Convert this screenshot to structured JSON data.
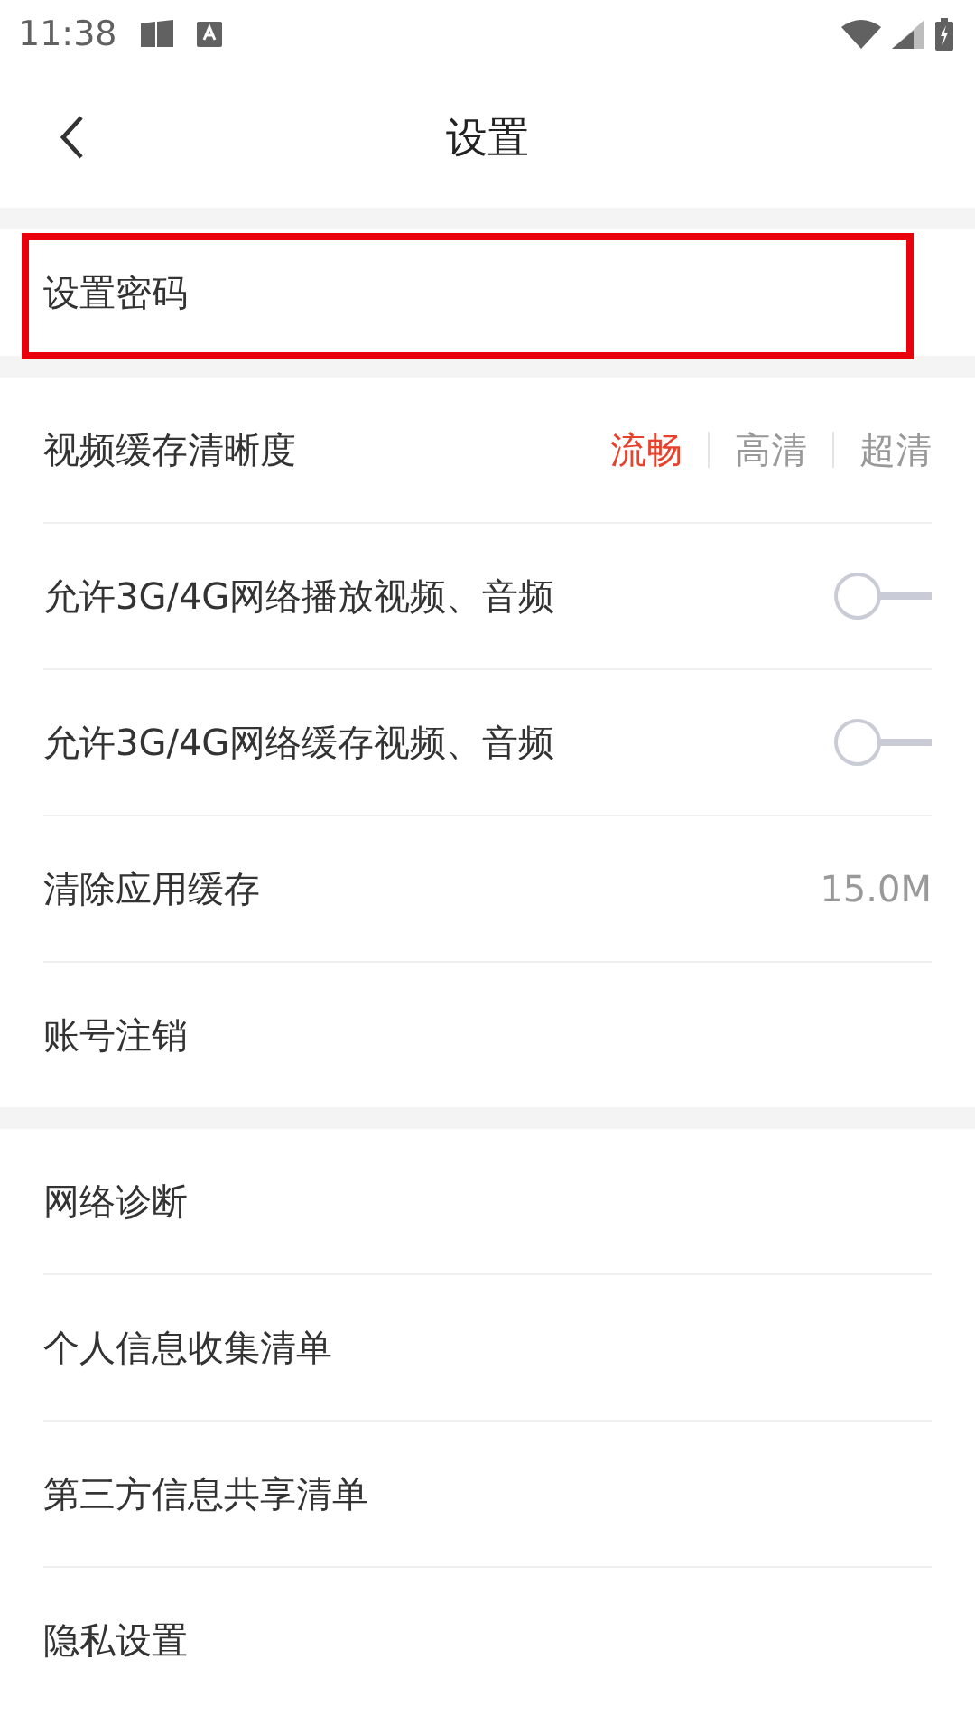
{
  "status_bar": {
    "time": "11:38"
  },
  "header": {
    "title": "设置"
  },
  "sections": [
    {
      "items": [
        {
          "kind": "plain",
          "label": "设置密码",
          "highlighted": true
        }
      ]
    },
    {
      "items": [
        {
          "kind": "quality",
          "label": "视频缓存清晰度",
          "options": [
            {
              "label": "流畅",
              "selected": true
            },
            {
              "label": "高清",
              "selected": false
            },
            {
              "label": "超清",
              "selected": false
            }
          ]
        },
        {
          "kind": "toggle",
          "label": "允许3G/4G网络播放视频、音频",
          "on": false
        },
        {
          "kind": "toggle",
          "label": "允许3G/4G网络缓存视频、音频",
          "on": false
        },
        {
          "kind": "value",
          "label": "清除应用缓存",
          "value": "15.0M"
        },
        {
          "kind": "plain",
          "label": "账号注销",
          "highlighted": false
        }
      ]
    },
    {
      "items": [
        {
          "kind": "plain",
          "label": "网络诊断",
          "highlighted": false
        },
        {
          "kind": "plain",
          "label": "个人信息收集清单",
          "highlighted": false
        },
        {
          "kind": "plain",
          "label": "第三方信息共享清单",
          "highlighted": false
        },
        {
          "kind": "plain",
          "label": "隐私设置",
          "highlighted": false
        }
      ]
    }
  ]
}
